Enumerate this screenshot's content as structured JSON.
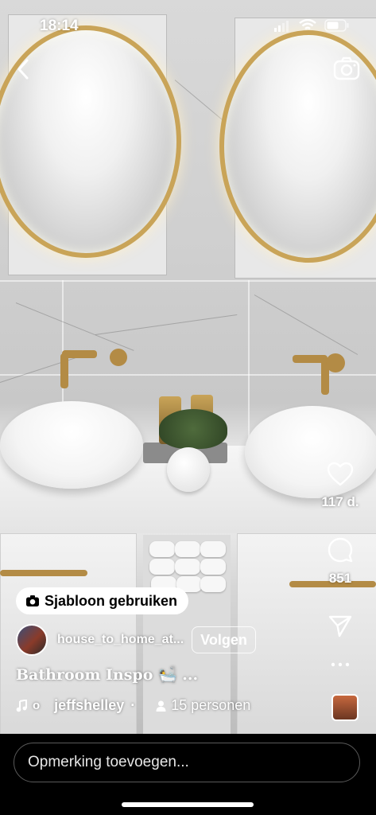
{
  "status_bar": {
    "time": "18:14"
  },
  "reel": {
    "template_button": "Sjabloon gebruiken",
    "username": "house_to_home_at...",
    "follow_label": "Volgen",
    "caption": "Bathroom Inspo 🛀 ...",
    "audio_artist": "jeffshelley",
    "audio_separator": "·",
    "people_count": "15 personen"
  },
  "actions": {
    "likes": "117 d.",
    "comments": "851"
  },
  "comment_bar": {
    "placeholder": "Opmerking toevoegen..."
  },
  "icons": {
    "back": "chevron-left-icon",
    "camera": "camera-icon",
    "like": "heart-icon",
    "comment": "comment-bubble-icon",
    "share": "paper-plane-icon",
    "more": "ellipsis-icon",
    "music": "music-note-icon",
    "person": "person-icon"
  },
  "colors": {
    "accent_gold": "#c9a458",
    "background": "#000000"
  }
}
